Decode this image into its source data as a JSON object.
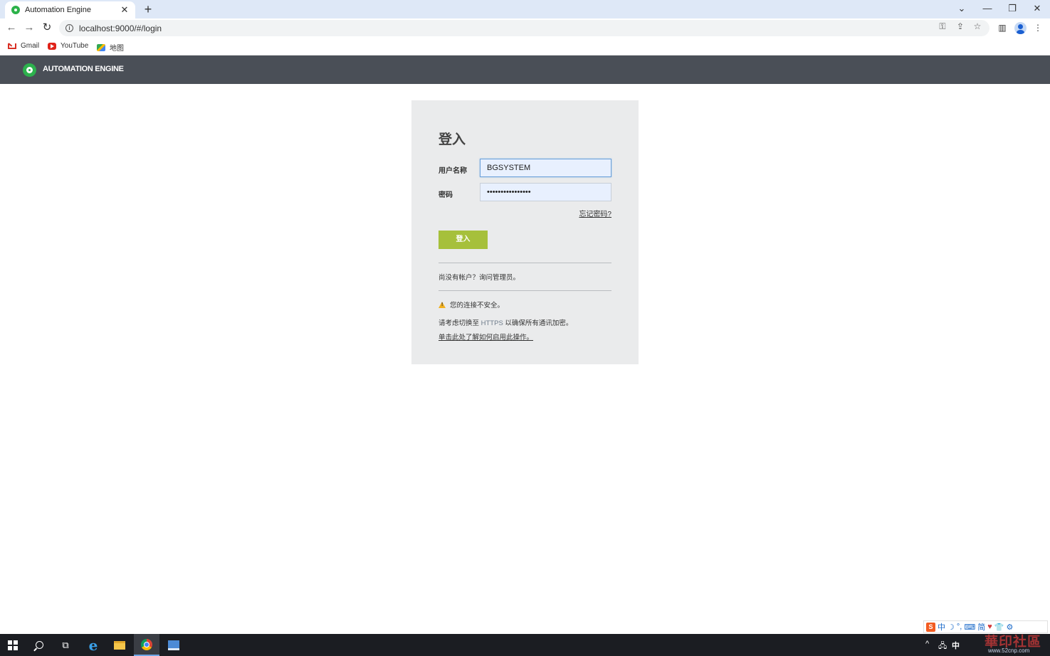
{
  "browser": {
    "tab_title": "Automation Engine",
    "tab_close": "✕",
    "new_tab": "+",
    "url": "localhost:9000/#/login",
    "window_controls": {
      "dropdown": "⌄",
      "minimize": "—",
      "restore": "❐",
      "close": "✕"
    },
    "nav": {
      "back": "←",
      "forward": "→",
      "reload": "↻"
    },
    "omnibox_icons": {
      "key": "⚿",
      "share": "⇪",
      "star": "☆"
    },
    "toolbar_icons": {
      "sidebar": "▥",
      "menu": "⋮"
    },
    "bookmarks": [
      {
        "label": "Gmail",
        "icon": "gmail-icon"
      },
      {
        "label": "YouTube",
        "icon": "youtube-icon"
      },
      {
        "label": "地图",
        "icon": "maps-icon"
      }
    ]
  },
  "app": {
    "name": "AUTOMATION ENGINE",
    "accent_color": "#2db14d",
    "header_color": "#4a4f57"
  },
  "login": {
    "title": "登入",
    "username_label": "用户名称",
    "username_value": "BGSYSTEM",
    "password_label": "密码",
    "password_value": "••••••••••••••••",
    "forgot_link": "忘记密码?",
    "submit_label": "登入",
    "submit_color": "#a6c03b",
    "no_account_text": "尚没有帐户？询问管理员。",
    "warning_text": "您的连接不安全。",
    "https_text_before": "请考虑切换至 ",
    "https_word": "HTTPS",
    "https_text_after": " 以确保所有通讯加密。",
    "learn_link": "单击此处了解如何启用此操作。"
  },
  "taskbar": {
    "apps": [
      "start-icon",
      "search-icon",
      "task-view-icon",
      "ie-icon",
      "file-explorer-icon",
      "chrome-icon",
      "app-icon"
    ],
    "tray": {
      "chevron": "^",
      "network": "🖧",
      "ime": "中"
    },
    "ime_bar": [
      "中",
      "☽",
      "°,",
      "⌨",
      "简",
      "♥",
      "👕",
      "⚙"
    ],
    "ime_logo": "S",
    "watermark": "華印社區",
    "watermark_url": "www.52cnp.com"
  }
}
